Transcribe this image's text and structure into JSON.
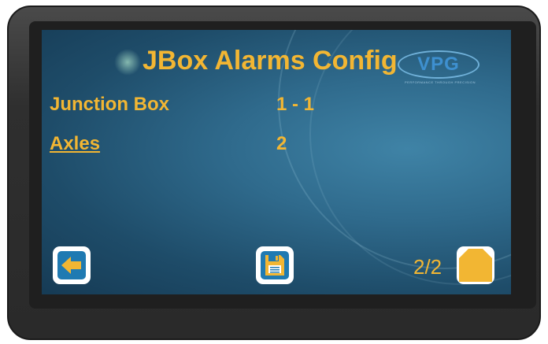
{
  "screen": {
    "title": "JBox Alarms Config",
    "logo_text": "VPG",
    "logo_tagline": "PERFORMANCE THROUGH PRECISION",
    "rows": [
      {
        "label": "Junction Box",
        "value": "1 - 1",
        "link": false
      },
      {
        "label": "Axles",
        "value": "2",
        "link": true
      }
    ],
    "page_indicator": "2/2"
  },
  "buttons": {
    "back": {
      "icon": "arrow-left-icon"
    },
    "save": {
      "icon": "floppy-disk-icon"
    },
    "home": {
      "icon": "home-icon"
    }
  },
  "colors": {
    "accent_text": "#f2b633",
    "button_blue": "#1f7ab2",
    "screen_bg": "#2f6a8c"
  }
}
